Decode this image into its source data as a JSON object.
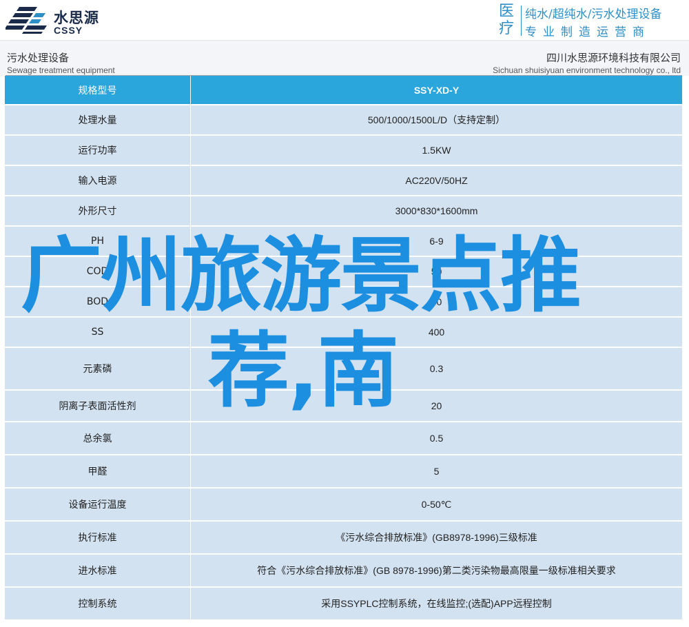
{
  "brand": {
    "name_cn": "水思源",
    "name_en": "CSSY",
    "logo_icon": "water-lines-logo-icon",
    "color": "#1a2a4a"
  },
  "slogan": {
    "big_chars": "医疗",
    "line1": "纯水/超纯水/污水处理设备",
    "line2": "专业制造运营商",
    "color": "#2e8fc7"
  },
  "subheader": {
    "left_cn": "污水处理设备",
    "left_en": "Sewage treatment equipment",
    "right_cn": "四川水思源环境科技有限公司",
    "right_en": "Sichuan shuisiyuan environment technology co., ltd"
  },
  "table": {
    "header_color": "#2aa6dc",
    "row_color": "#d3e2f1",
    "header": {
      "key": "规格型号",
      "value": "SSY-XD-Y"
    },
    "rows": [
      {
        "key": "处理水量",
        "value": "500/1000/1500L/D（支持定制）"
      },
      {
        "key": "运行功率",
        "value": "1.5KW"
      },
      {
        "key": "输入电源",
        "value": "AC220V/50HZ"
      },
      {
        "key": "外形尺寸",
        "value": "3000*830*1600mm"
      },
      {
        "key": "PH",
        "value": "6-9"
      },
      {
        "key": "COD",
        "value": "50"
      },
      {
        "key": "BOD",
        "value": "30"
      },
      {
        "key": "SS",
        "value": "400"
      },
      {
        "key": "元素磷",
        "value": "0.3"
      },
      {
        "key": "阴离子表面活性剂",
        "value": "20"
      },
      {
        "key": "总余氯",
        "value": "0.5"
      },
      {
        "key": "甲醛",
        "value": "5"
      },
      {
        "key": "设备运行温度",
        "value": "0-50℃"
      },
      {
        "key": "执行标准",
        "value": "《污水综合排放标准》(GB8978-1996)三级标准"
      },
      {
        "key": "进水标准",
        "value": "符合《污水综合排放标准》(GB 8978-1996)第二类污染物最高限量一级标准相关要求"
      },
      {
        "key": "控制系统",
        "value": "采用SSYPLC控制系统，在线监控;(选配)APP远程控制"
      }
    ]
  },
  "overlay": {
    "line1": "广州旅游景点推",
    "line2": "荐,南",
    "color": "#1d8fe0"
  }
}
